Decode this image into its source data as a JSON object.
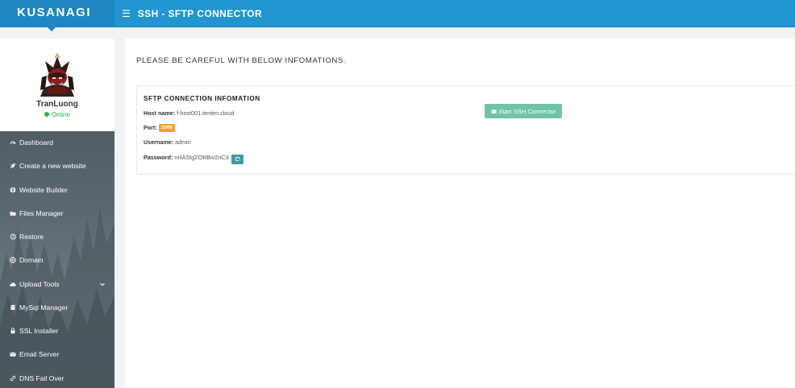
{
  "brand": {
    "name": "KUSANAGI"
  },
  "header": {
    "title": "SSH - SFTP CONNECTOR",
    "menu_icon": "hamburger-icon"
  },
  "profile": {
    "name": "TranLuong",
    "status": "Online",
    "status_color": "#29b24a"
  },
  "sidebar": {
    "items": [
      {
        "label": "Dashboard",
        "icon": "dashboard-icon"
      },
      {
        "label": "Create a new website",
        "icon": "rocket-icon"
      },
      {
        "label": "Website Builder",
        "icon": "globe-icon"
      },
      {
        "label": "Files Manager",
        "icon": "folder-icon"
      },
      {
        "label": "Restore",
        "icon": "history-icon"
      },
      {
        "label": "Domain",
        "icon": "globe-grid-icon"
      },
      {
        "label": "Upload Tools",
        "icon": "cloud-upload-icon",
        "expandable": true
      },
      {
        "label": "MySql Manager",
        "icon": "database-icon"
      },
      {
        "label": "SSL Installer",
        "icon": "lock-icon"
      },
      {
        "label": "Email Server",
        "icon": "envelope-icon"
      },
      {
        "label": "DNS Fail Over",
        "icon": "link-icon"
      }
    ]
  },
  "main": {
    "warning": "PLEASE BE CAREFUL WITH BELOW INFOMATIONS.",
    "panel_title": "SFTP CONNECTION INFOMATION",
    "host_label": "Host name:",
    "host_value": "f-host001.tenten.cloud",
    "port_label": "Port:",
    "port_value": "22999",
    "username_label": "Username:",
    "username_value": "admin",
    "password_label": "Password:",
    "password_value": "nHAStgZORBiv2nCX",
    "ssh_button": "Start SSH Connector"
  },
  "colors": {
    "topbar": "#2295d1",
    "brand": "#1e87c2",
    "port_badge": "#f7a01c",
    "ssh_button": "#6fc3a6",
    "refresh_button": "#3d9ca5"
  }
}
